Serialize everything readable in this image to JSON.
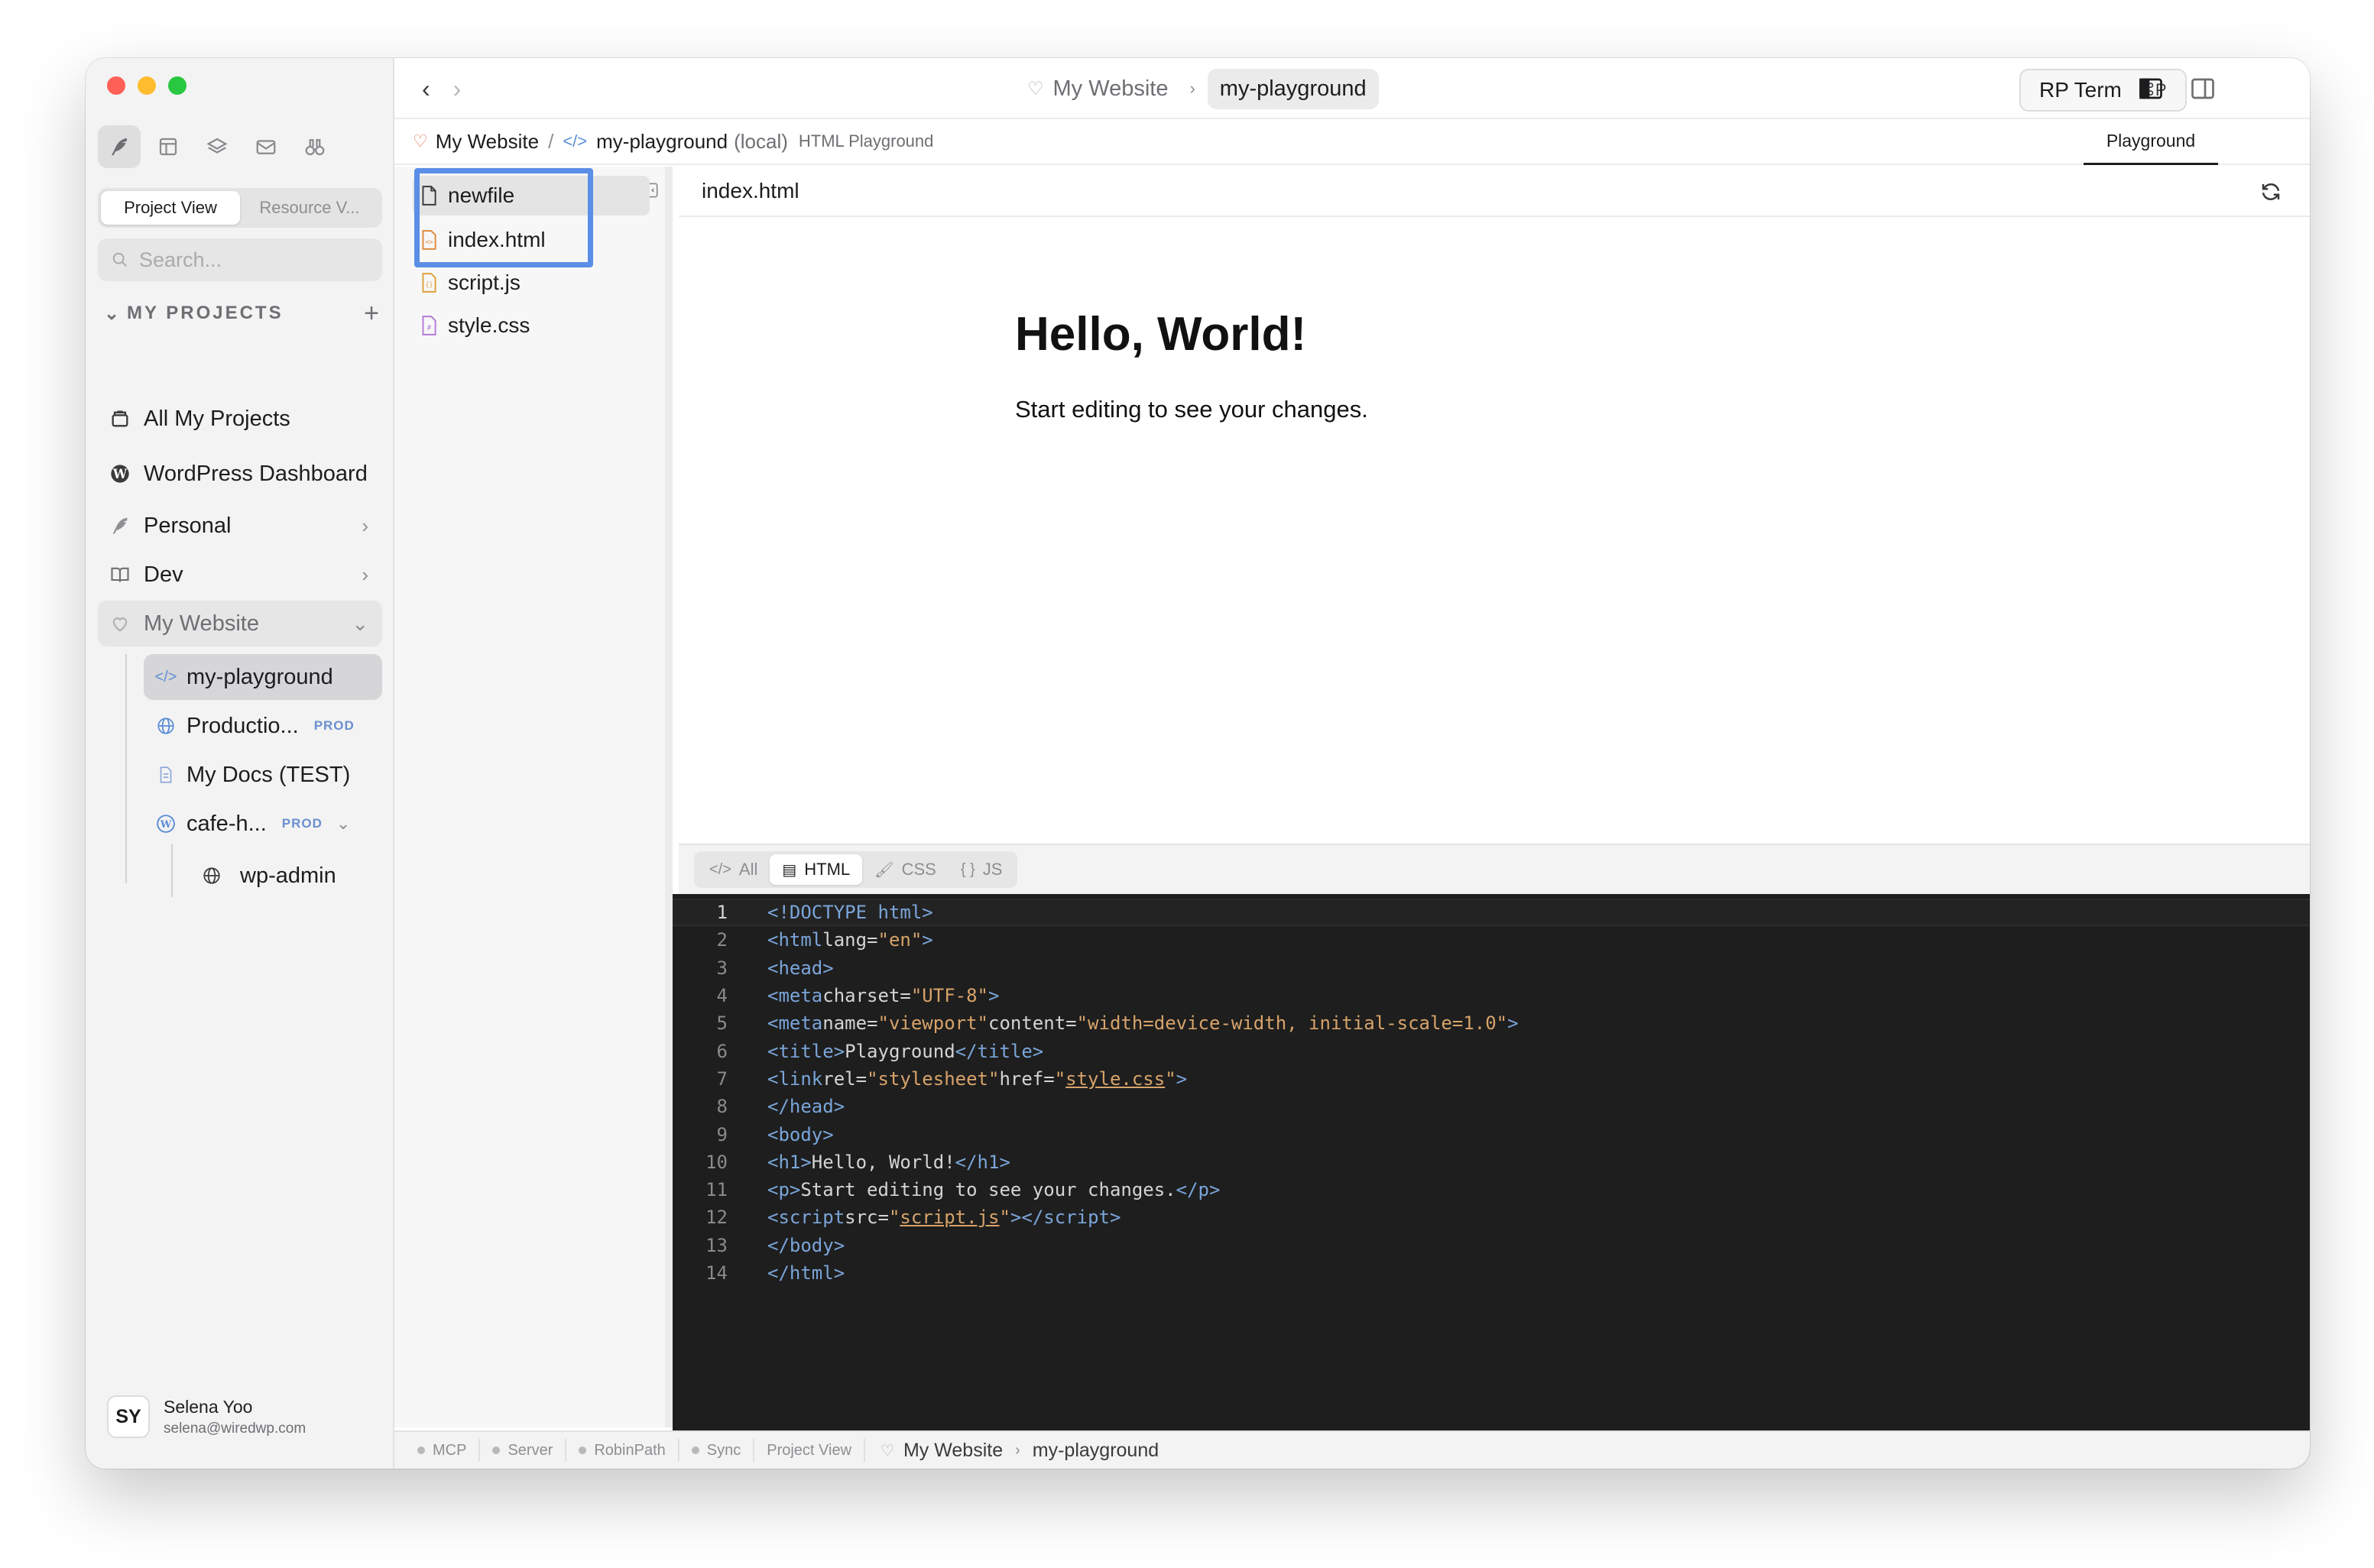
{
  "window": {
    "title": "My Website › my-playground"
  },
  "sidebar": {
    "view_tabs": [
      "Project View",
      "Resource V..."
    ],
    "search_placeholder": "Search...",
    "section_title": "MY PROJECTS",
    "items": [
      {
        "label": "All My Projects",
        "icon": "archive-icon"
      },
      {
        "label": "WordPress Dashboard",
        "icon": "wordpress-icon"
      },
      {
        "label": "Personal",
        "icon": "feather-icon"
      },
      {
        "label": "Dev",
        "icon": "book-icon"
      },
      {
        "label": "My Website",
        "icon": "heart-icon"
      }
    ],
    "sub_items": [
      {
        "label": "my-playground",
        "icon": "code-icon"
      },
      {
        "label": "Productio...",
        "badge": "PROD",
        "icon": "globe-icon"
      },
      {
        "label": "My Docs (TEST)",
        "icon": "document-icon"
      },
      {
        "label": "cafe-h...",
        "badge": "PROD",
        "icon": "wordpress-icon"
      },
      {
        "label": "wp-admin",
        "icon": "globe-icon"
      }
    ],
    "user": {
      "initials": "SY",
      "name": "Selena Yoo",
      "email": "selena@wiredwp.com"
    }
  },
  "topbar": {
    "back": "‹",
    "forward": "›",
    "crumb_parent": "My Website",
    "crumb_current": "my-playground",
    "rp_term_label": "RP Term",
    "rp_term_shortcut": "⌘P"
  },
  "breadcrumb": {
    "root": "My Website",
    "project": "my-playground",
    "scope": "(local)",
    "type": "HTML Playground",
    "active_tab": "Playground"
  },
  "files": {
    "editing_value": "newfile",
    "list": [
      {
        "name": "index.html",
        "icon": "html-file-icon",
        "color": "#e08a3c"
      },
      {
        "name": "script.js",
        "icon": "js-file-icon",
        "color": "#e0a23c"
      },
      {
        "name": "style.css",
        "icon": "css-file-icon",
        "color": "#b57ad9"
      }
    ]
  },
  "preview": {
    "filename": "index.html",
    "heading": "Hello, World!",
    "paragraph": "Start editing to see your changes."
  },
  "editor": {
    "tabs": [
      {
        "glyph": "</>",
        "label": "All"
      },
      {
        "glyph": "▤",
        "label": "HTML"
      },
      {
        "glyph": "🖌",
        "label": "CSS"
      },
      {
        "glyph": "{ }",
        "label": "JS"
      }
    ],
    "active_tab": "HTML",
    "current_line": 1
  },
  "statusbar": {
    "items": [
      "MCP",
      "Server",
      "RobinPath",
      "Sync"
    ],
    "view": "Project View",
    "crumb_parent": "My Website",
    "crumb_current": "my-playground"
  },
  "colors": {
    "accent_blue": "#5b8ee6",
    "close": "#fe5f57",
    "minimize": "#febc2e",
    "zoom": "#28c840"
  }
}
